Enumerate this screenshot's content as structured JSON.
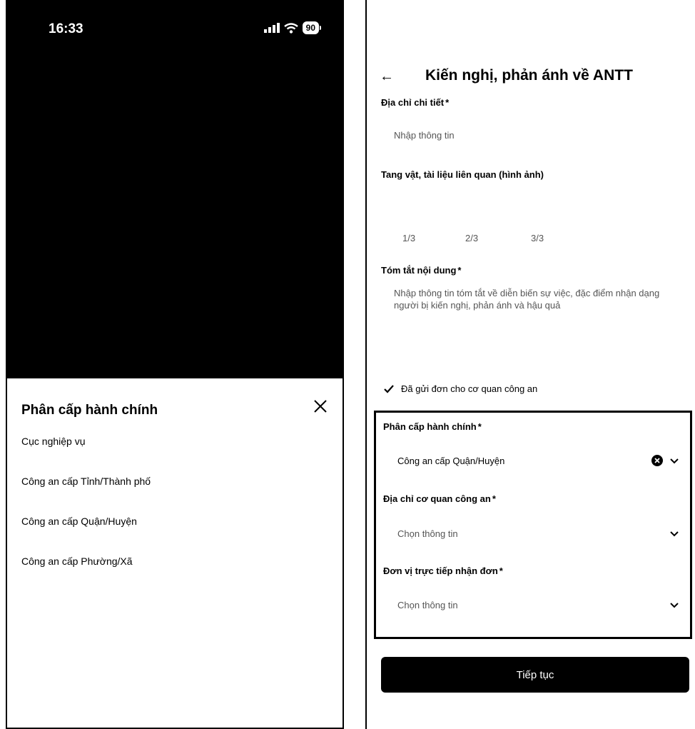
{
  "left_screen": {
    "status_bar": {
      "time": "16:33",
      "battery": "90",
      "signal_icon": "cellular-signal-icon",
      "wifi_icon": "wifi-icon"
    },
    "sheet": {
      "title": "Phân cấp hành chính",
      "close_icon": "close-icon",
      "options": [
        "Cục nghiệp vụ",
        "Công an cấp Tỉnh/Thành phố",
        "Công an cấp Quận/Huyện",
        "Công an cấp Phường/Xã"
      ]
    }
  },
  "right_screen": {
    "header": {
      "back_icon": "back-arrow-icon",
      "title": "Kiến nghị, phản ánh về ANTT"
    },
    "address": {
      "label": "Địa chỉ chi tiết",
      "required_mark": "*",
      "placeholder": "Nhập thông tin"
    },
    "evidence": {
      "label": "Tang vật, tài liệu liên quan (hình ảnh)",
      "counters": [
        "1/3",
        "2/3",
        "3/3"
      ]
    },
    "summary": {
      "label": "Tóm tắt nội dung",
      "required_mark": "*",
      "placeholder": "Nhập thông tin tóm tắt về diễn biến sự việc, đặc điểm nhận dạng người bị kiến nghị, phản ánh và hậu quả"
    },
    "sent_checkbox": {
      "label": "Đã gửi đơn cho cơ quan công an",
      "checked": true
    },
    "admin_level": {
      "label": "Phân cấp hành chính",
      "required_mark": "*",
      "value": "Công an cấp Quận/Huyện"
    },
    "police_address": {
      "label": "Địa chỉ cơ quan công an",
      "required_mark": "*",
      "placeholder": "Chọn thông tin"
    },
    "receiving_unit": {
      "label": "Đơn vị trực tiếp nhận đơn",
      "required_mark": "*",
      "placeholder": "Chọn thông tin"
    },
    "continue_button": "Tiếp tục"
  },
  "colors": {
    "background": "#ffffff",
    "dark": "#000000",
    "placeholder": "#555555"
  }
}
